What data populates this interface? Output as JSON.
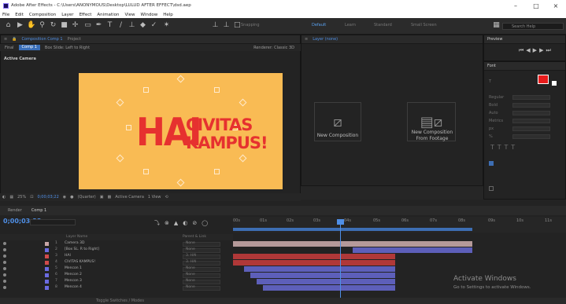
{
  "window": {
    "title": "Adobe After Effects - C:\\Users\\ANONYMOUS\\Desktop\\LULUD AFTER EFFECT\\dsd.aep",
    "controls": [
      "–",
      "□",
      "×"
    ]
  },
  "menu": [
    "File",
    "Edit",
    "Composition",
    "Layer",
    "Effect",
    "Animation",
    "View",
    "Window",
    "Help"
  ],
  "toolbar": {
    "snapping_label": "Snapping",
    "workspaces": [
      "Default",
      "Learn",
      "Standard",
      "Small Screen"
    ],
    "active_workspace": "Default",
    "search_placeholder": "Search Help"
  },
  "composition_panel": {
    "tab_label": "Composition Comp 1",
    "tab2_label": "Project",
    "breadcrumb_final": "Final",
    "breadcrumb_comp": "Comp 1",
    "breadcrumb_layer": "Box Slide: Left to Right",
    "renderer": "Renderer: Classic 3D",
    "active_camera": "Active Camera",
    "canvas_text_big": "HAI",
    "canvas_text_line1": "CIVITAS",
    "canvas_text_line2": "KAMPUS!",
    "canvas_color": "#f9bb54",
    "text_color": "#e6312f"
  },
  "viewer_controls": {
    "zoom": "25%",
    "timecode": "0;00;03;22",
    "resolution": "(Quarter)",
    "camera": "Active Camera",
    "views": "1 View"
  },
  "layer_panel": {
    "tab_label": "Layer (none)",
    "new_composition": "New Composition",
    "new_comp_from_footage_line1": "New Composition",
    "new_comp_from_footage_line2": "From Footage"
  },
  "preview_panel": {
    "tab_label": "Preview"
  },
  "character_panel": {
    "tab_label": "Font",
    "rows": [
      "Regular",
      "Bold",
      "Auto",
      "Metrics",
      "px",
      "%"
    ]
  },
  "timeline": {
    "tab_render": "Render",
    "tab_comp": "Comp 1",
    "timecode": "0;00;03;22",
    "col_layer_name": "Layer Name",
    "col_parent": "Parent & Link",
    "ruler_ticks": [
      "00s",
      "01s",
      "02s",
      "03s",
      "04s",
      "05s",
      "06s",
      "07s",
      "08s",
      "09s",
      "10s",
      "11s"
    ],
    "toggle_label": "Toggle Switches / Modes",
    "layers": [
      {
        "num": "1",
        "name": "Camera 3D",
        "parent": "None",
        "swatch": "#c8a6a6"
      },
      {
        "num": "2",
        "name": "[Box SL. R to Right]",
        "parent": "None",
        "swatch": "#6b6be0"
      },
      {
        "num": "3",
        "name": "HAI",
        "parent": "3. HAI",
        "swatch": "#d14b4b"
      },
      {
        "num": "4",
        "name": "CIVITAS KAMPUS!",
        "parent": "3. HAI",
        "swatch": "#d14b4b"
      },
      {
        "num": "5",
        "name": "Mencon 1",
        "parent": "None",
        "swatch": "#6b6be0"
      },
      {
        "num": "6",
        "name": "Mencon 2",
        "parent": "None",
        "swatch": "#6b6be0"
      },
      {
        "num": "7",
        "name": "Mencon 3",
        "parent": "None",
        "swatch": "#6b6be0"
      },
      {
        "num": "8",
        "name": "Mencon 4",
        "parent": "None",
        "swatch": "#6b6be0"
      }
    ]
  },
  "watermark": {
    "title": "Activate Windows",
    "subtitle": "Go to Settings to activate Windows."
  }
}
